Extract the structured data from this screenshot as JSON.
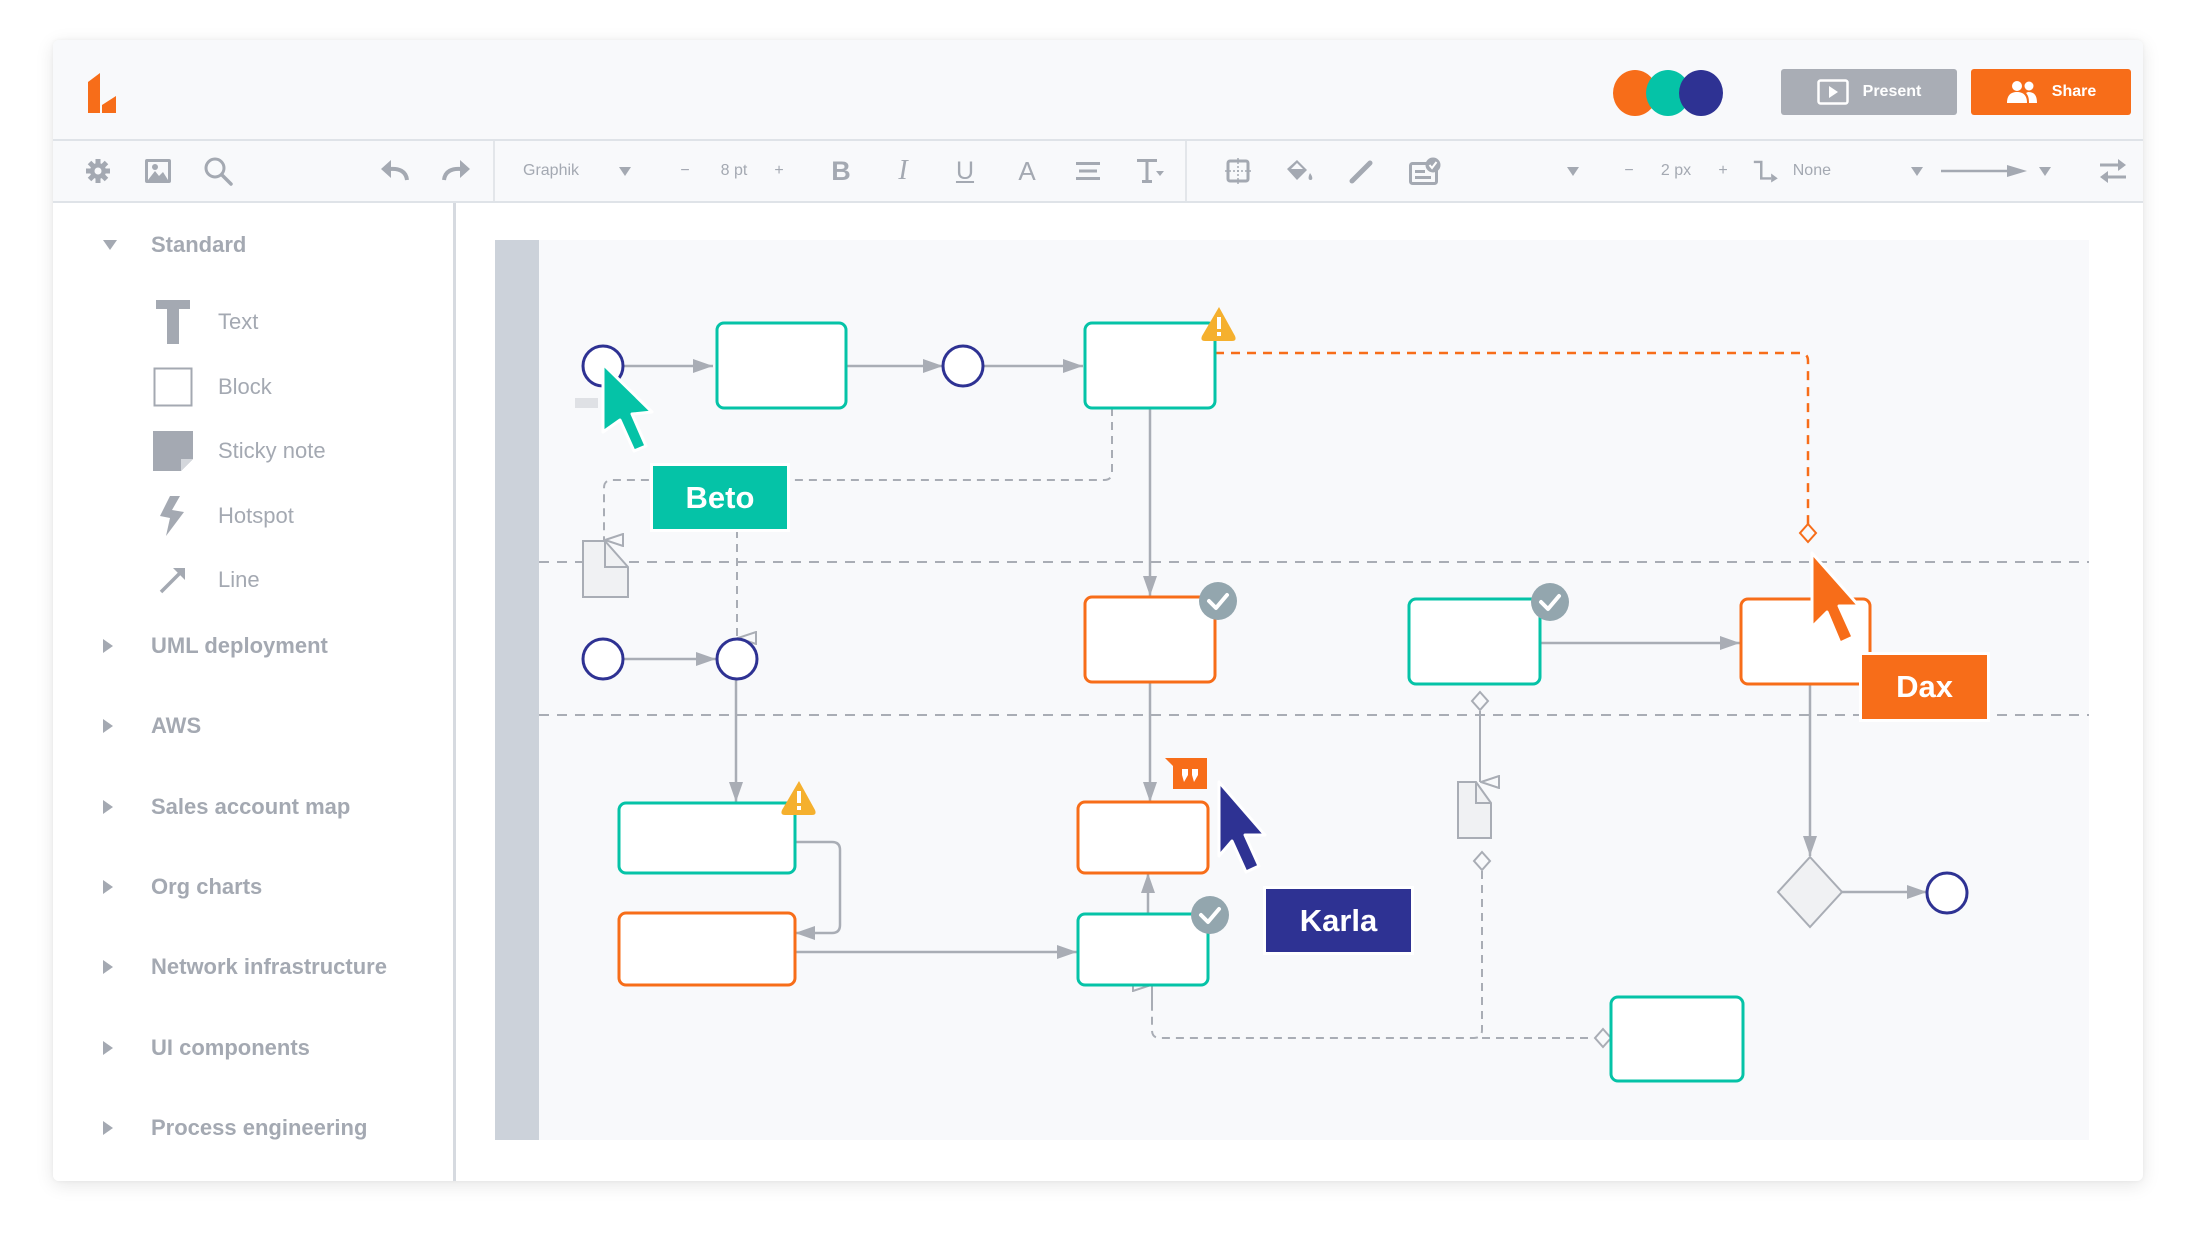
{
  "app": {
    "logo": "lucidchart-logo",
    "brand_color": "#f76d19"
  },
  "header": {
    "collaborators": [
      {
        "name": "Dax",
        "color": "#f76d19"
      },
      {
        "name": "Beto",
        "color": "#05c3a7"
      },
      {
        "name": "Karla",
        "color": "#2e3293"
      }
    ],
    "present_label": "Present",
    "share_label": "Share"
  },
  "toolbar": {
    "left_icons": [
      "gear-icon",
      "image-icon",
      "search-icon",
      "undo-icon",
      "redo-icon"
    ],
    "font_family": "Graphik",
    "font_size": "8 pt",
    "minus": "−",
    "plus": "+",
    "text_icons": [
      "bold-icon",
      "italic-icon",
      "underline-icon",
      "text-color-icon",
      "align-icon",
      "text-options-icon"
    ],
    "shape_icons": [
      "position-icon",
      "fill-icon",
      "line-color-icon",
      "style-icon"
    ],
    "line_width": "2 px",
    "line_style": "None",
    "swap_icon": "swap-arrows-icon"
  },
  "sidebar": {
    "sections": [
      {
        "label": "Standard",
        "expanded": true,
        "items": [
          {
            "label": "Text",
            "icon": "text-icon"
          },
          {
            "label": "Block",
            "icon": "block-icon"
          },
          {
            "label": "Sticky note",
            "icon": "sticky-note-icon"
          },
          {
            "label": "Hotspot",
            "icon": "hotspot-icon"
          },
          {
            "label": "Line",
            "icon": "line-icon"
          }
        ]
      },
      {
        "label": "UML deployment",
        "expanded": false
      },
      {
        "label": "AWS",
        "expanded": false
      },
      {
        "label": "Sales account map",
        "expanded": false
      },
      {
        "label": "Org charts",
        "expanded": false
      },
      {
        "label": "Network infrastructure",
        "expanded": false
      },
      {
        "label": "UI components",
        "expanded": false
      },
      {
        "label": "Process engineering",
        "expanded": false
      }
    ]
  },
  "canvas": {
    "colors": {
      "teal": "#05c3a7",
      "orange": "#f76d19",
      "navy": "#2e3293",
      "connector": "#a9adb5",
      "warning": "#f5b02e",
      "check": "#93a6ae"
    },
    "cursors": [
      {
        "user": "Beto",
        "color": "#05c3a7"
      },
      {
        "user": "Dax",
        "color": "#f76d19"
      },
      {
        "user": "Karla",
        "color": "#2e3293"
      }
    ],
    "badges": {
      "warning": "!",
      "comment": "comment-icon",
      "check": "check-icon"
    }
  }
}
